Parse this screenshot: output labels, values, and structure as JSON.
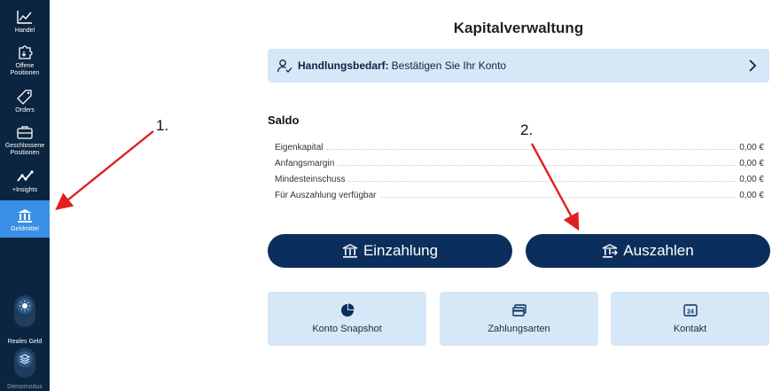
{
  "sidebar": {
    "items": [
      {
        "label": "Handel",
        "icon": "line-chart-icon"
      },
      {
        "label": "Offene\nPositionen",
        "icon": "puzzle-icon"
      },
      {
        "label": "Orders",
        "icon": "tag-icon"
      },
      {
        "label": "Geschlossene\nPositionen",
        "icon": "briefcase-icon"
      },
      {
        "label": "+Insights",
        "icon": "insights-icon"
      },
      {
        "label": "Geldmittel",
        "icon": "bank-icon"
      }
    ],
    "real_money_label": "Reales Geld",
    "demo_label": "Demomodus"
  },
  "main": {
    "title": "Kapitalverwaltung",
    "action_required": {
      "strong": "Handlungsbedarf:",
      "text": "Bestätigen Sie Ihr Konto"
    },
    "saldo": {
      "title": "Saldo",
      "rows": [
        {
          "label": "Eigenkapital",
          "value": "0,00 €"
        },
        {
          "label": "Anfangsmargin",
          "value": "0,00 €"
        },
        {
          "label": "Mindesteinschuss",
          "value": "0,00 €"
        },
        {
          "label": "Für Auszahlung verfügbar",
          "value": "0,00 €"
        }
      ]
    },
    "buttons": {
      "deposit": "Einzahlung",
      "withdraw": "Auszahlen"
    },
    "cards": [
      {
        "label": "Konto Snapshot",
        "icon": "pie-chart-icon"
      },
      {
        "label": "Zahlungsarten",
        "icon": "credit-card-icon"
      },
      {
        "label": "Kontakt",
        "icon": "contact-24-icon"
      }
    ]
  },
  "annotations": {
    "one": "1.",
    "two": "2."
  },
  "colors": {
    "sidebar_bg": "#0b2540",
    "active_bg": "#3a8ee6",
    "button_bg": "#0b2f5c",
    "card_bg": "#d6e7f7",
    "arrow": "#e02020"
  }
}
